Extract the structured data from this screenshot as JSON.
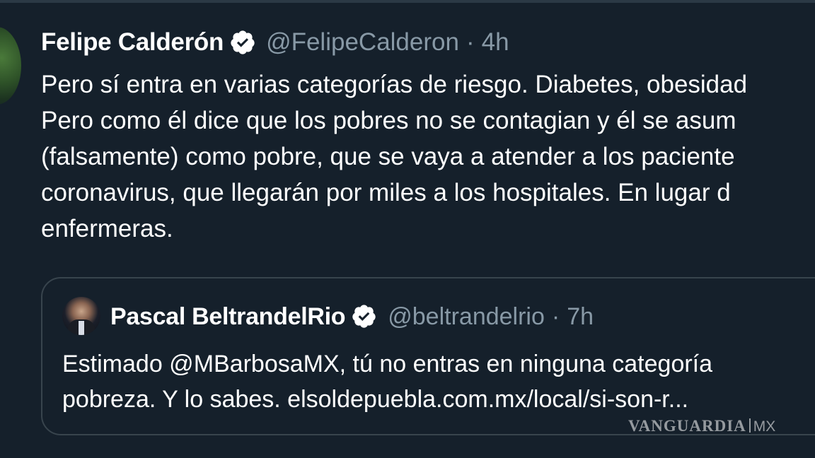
{
  "tweet": {
    "author": {
      "name": "Felipe Calderón",
      "handle": "@FelipeCalderon",
      "verified": true
    },
    "separator": "·",
    "time": "4h",
    "text_lines": [
      "Pero sí entra en varias categorías de riesgo. Diabetes, obesidad",
      "Pero como él dice que los pobres no se contagian y él se asum",
      "(falsamente) como pobre, que se vaya a atender a los paciente",
      "coronavirus, que llegarán por miles a los hospitales. En lugar d",
      "enfermeras."
    ]
  },
  "quoted_tweet": {
    "author": {
      "name": "Pascal BeltrandelRio",
      "handle": "@beltrandelrio",
      "verified": true
    },
    "separator": "·",
    "time": "7h",
    "text_lines": [
      "Estimado @MBarbosaMX, tú no entras en ninguna categoría",
      "pobreza. Y lo sabes.  elsoldepuebla.com.mx/local/si-son-r..."
    ]
  },
  "watermark": {
    "brand": "VANGUARDIA",
    "suffix": "MX"
  },
  "colors": {
    "background": "#15202b",
    "text": "#ffffff",
    "secondary_text": "#8899a6",
    "border": "#38444d",
    "verified_badge": "#ffffff"
  },
  "icons": {
    "verified": "verified-badge-icon"
  }
}
